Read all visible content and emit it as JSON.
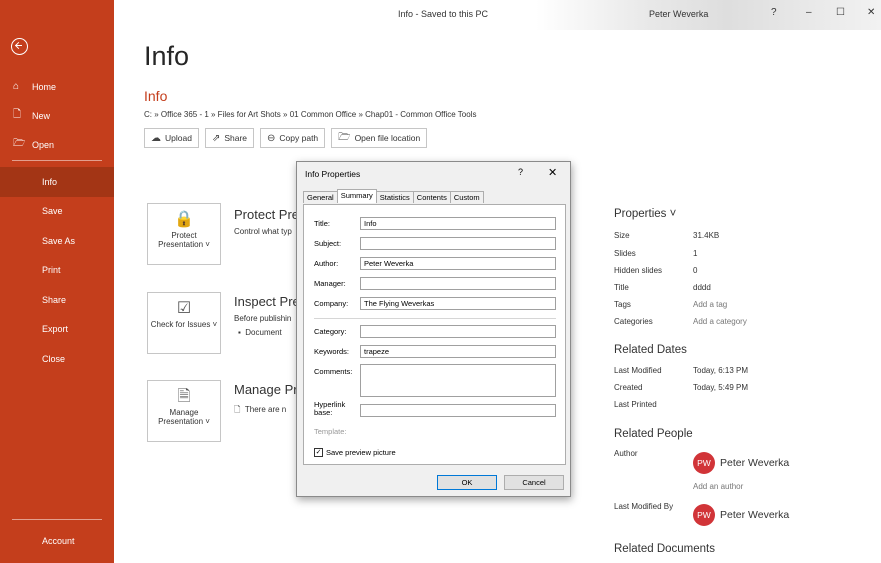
{
  "titlebar": {
    "title": "Info - Saved to this PC",
    "user": "Peter Weverka",
    "help": "?",
    "minimize": "–",
    "maximize": "☐",
    "close": "✕"
  },
  "sidebar": {
    "top_items": [
      {
        "label": "Home",
        "icon": "home-icon"
      },
      {
        "label": "New",
        "icon": "new-document-icon"
      },
      {
        "label": "Open",
        "icon": "open-folder-icon"
      }
    ],
    "main_items": [
      "Info",
      "Save",
      "Save As",
      "Print",
      "Share",
      "Export",
      "Close"
    ],
    "active": "Info",
    "account": "Account"
  },
  "main": {
    "page_title": "Info",
    "doc_name": "Info",
    "path": "C: » Office 365 - 1 » Files for Art Shots » 01 Common Office » Chap01 - Common Office Tools",
    "buttons": [
      "Upload",
      "Share",
      "Copy path",
      "Open file location"
    ],
    "sections": [
      {
        "button": "Protect Presentation ˅",
        "title": "Protect Pre",
        "desc": "Control what typ"
      },
      {
        "button": "Check for Issues ˅",
        "title": "Inspect Pre",
        "desc": "Before publishin",
        "bullet": "Document"
      },
      {
        "button": "Manage Presentation ˅",
        "title": "Manage Pr",
        "desc": "There are n"
      }
    ]
  },
  "properties": {
    "heading": "Properties ˅",
    "rows": [
      {
        "label": "Size",
        "value": "31.4KB"
      },
      {
        "label": "Slides",
        "value": "1"
      },
      {
        "label": "Hidden slides",
        "value": "0"
      },
      {
        "label": "Title",
        "value": "dddd"
      },
      {
        "label": "Tags",
        "value": "Add a tag"
      },
      {
        "label": "Categories",
        "value": "Add a category"
      }
    ],
    "related_dates": {
      "heading": "Related Dates",
      "rows": [
        {
          "label": "Last Modified",
          "value": "Today, 6:13 PM"
        },
        {
          "label": "Created",
          "value": "Today, 5:49 PM"
        },
        {
          "label": "Last Printed",
          "value": ""
        }
      ]
    },
    "related_people": {
      "heading": "Related People",
      "author_label": "Author",
      "author_initials": "PW",
      "author_name": "Peter Weverka",
      "add_author": "Add an author",
      "last_modified_label": "Last Modified By",
      "last_modified_initials": "PW",
      "last_modified_name": "Peter Weverka"
    },
    "related_documents": "Related Documents"
  },
  "dialog": {
    "title": "Info Properties",
    "help": "?",
    "close": "✕",
    "tabs": [
      "General",
      "Summary",
      "Statistics",
      "Contents",
      "Custom"
    ],
    "active_tab": "Summary",
    "fields": {
      "title": {
        "label": "Title:",
        "value": "Info"
      },
      "subject": {
        "label": "Subject:",
        "value": ""
      },
      "author": {
        "label": "Author:",
        "value": "Peter Weverka"
      },
      "manager": {
        "label": "Manager:",
        "value": ""
      },
      "company": {
        "label": "Company:",
        "value": "The Flying Weverkas"
      },
      "category": {
        "label": "Category:",
        "value": ""
      },
      "keywords": {
        "label": "Keywords:",
        "value": "trapeze"
      },
      "comments": {
        "label": "Comments:",
        "value": ""
      },
      "hyperlink": {
        "label": "Hyperlink base:",
        "value": ""
      },
      "template": {
        "label": "Template:"
      }
    },
    "save_preview": "Save preview picture",
    "ok": "OK",
    "cancel": "Cancel"
  },
  "colors": {
    "accent": "#c43e1c",
    "active_nav": "#a33515",
    "avatar": "#d13438"
  }
}
